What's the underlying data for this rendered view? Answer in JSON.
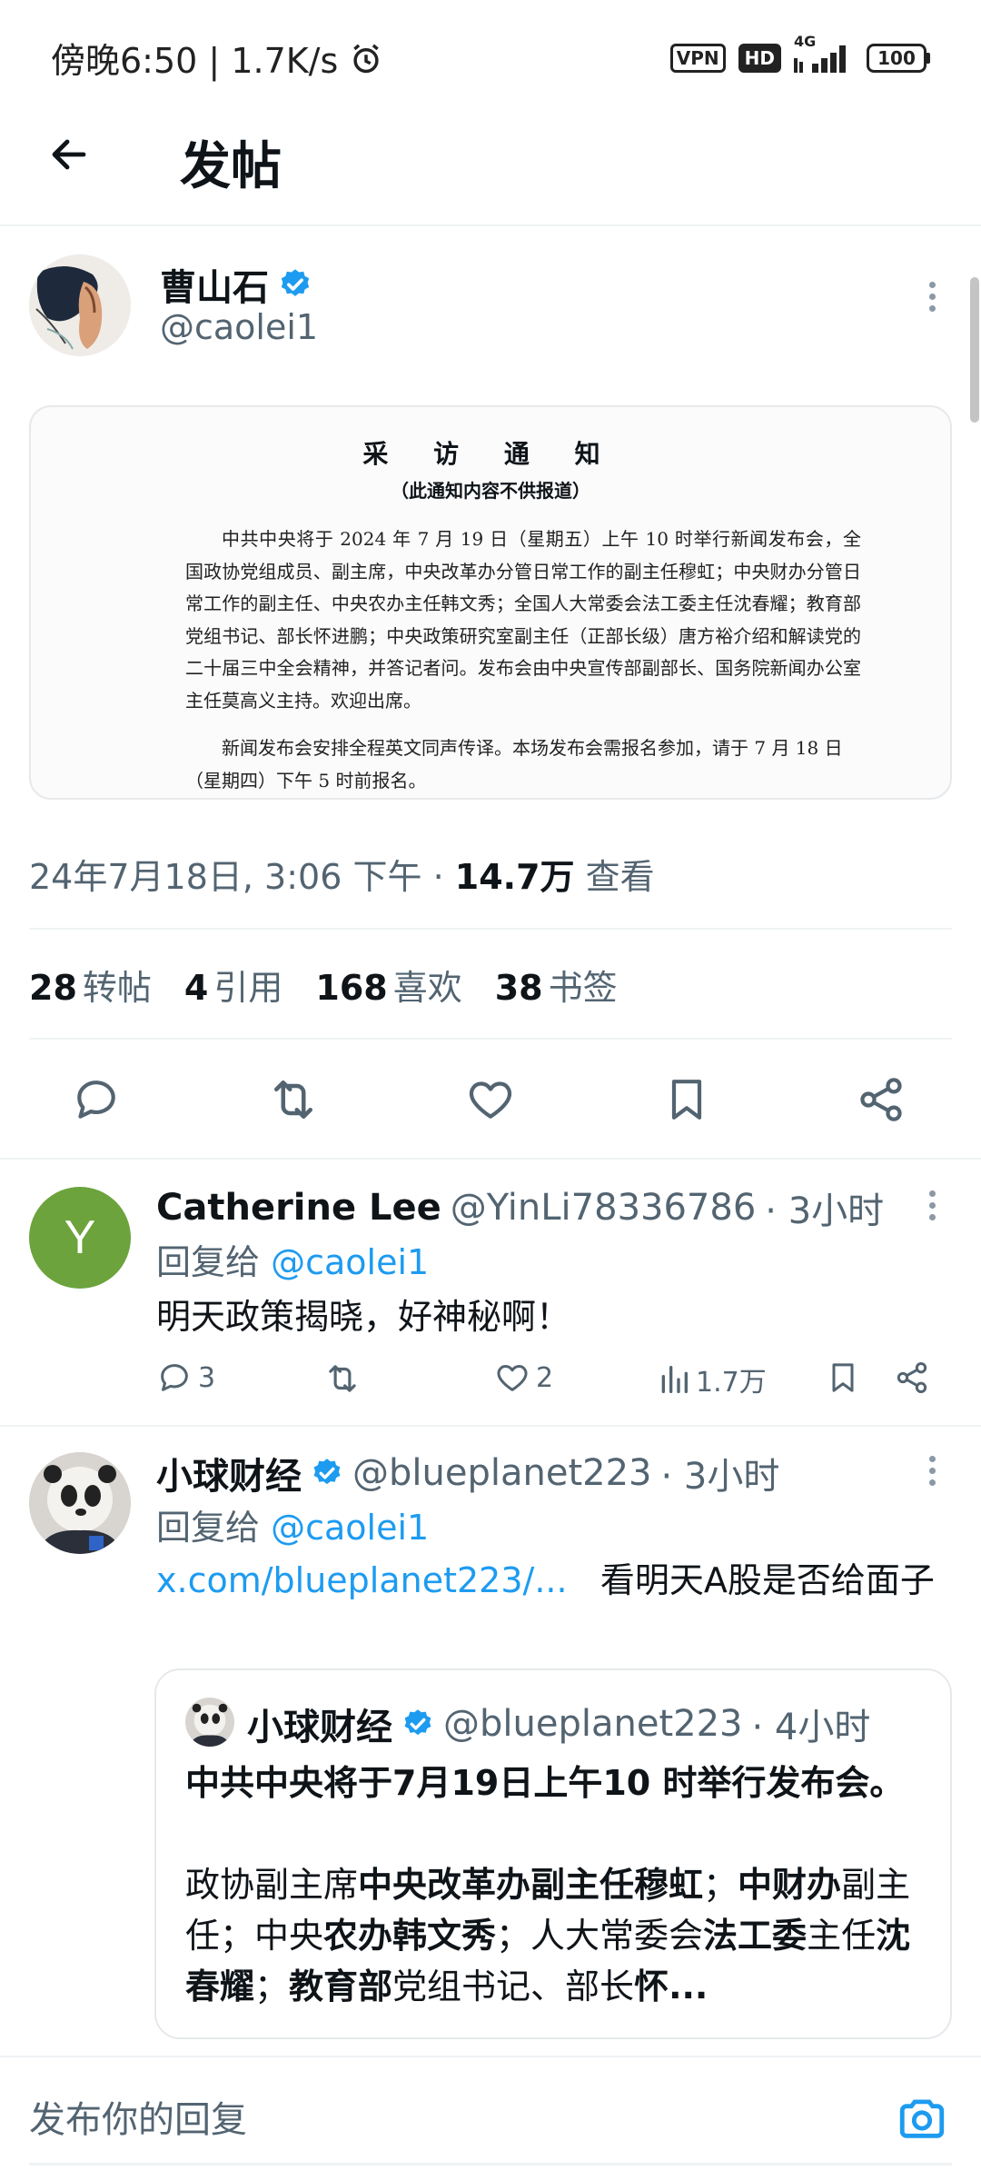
{
  "status_bar": {
    "time": "傍晚6:50",
    "speed": "1.7K/s",
    "vpn": "VPN",
    "hd": "HD",
    "network": "4G",
    "battery": "100"
  },
  "header": {
    "title": "发帖"
  },
  "post": {
    "author_name": "曹山石",
    "author_handle": "@caolei1",
    "image": {
      "title": "采 访 通 知",
      "subtitle": "（此通知内容不供报道）",
      "body": "中共中央将于 2024 年 7 月 19 日（星期五）上午 10 时举行新闻发布会，全国政协党组成员、副主席，中央改革办分管日常工作的副主任穆虹；中央财办分管日常工作的副主任、中央农办主任韩文秀；全国人大常委会法工委主任沈春耀；教育部党组书记、部长怀进鹏；中央政策研究室副主任（正部长级）唐方裕介绍和解读党的二十届三中全会精神，并答记者问。发布会由中央宣传部副部长、国务院新闻办公室主任莫高义主持。欢迎出席。",
      "body2": "新闻发布会安排全程英文同声传译。本场发布会需报名参加，请于 7 月 18 日（星期四）下午 5 时前报名。"
    },
    "timestamp": "24年7月18日, 3:06 下午",
    "separator": "·",
    "views_count": "14.7万",
    "views_label": "查看",
    "stats": {
      "reposts_count": "28",
      "reposts_label": "转帖",
      "quotes_count": "4",
      "quotes_label": "引用",
      "likes_count": "168",
      "likes_label": "喜欢",
      "bookmarks_count": "38",
      "bookmarks_label": "书签"
    }
  },
  "replies": [
    {
      "avatar_letter": "Y",
      "avatar_color": "#6ca33d",
      "name": "Catherine Lee",
      "handle": "@YinLi78336786",
      "time": "· 3小时",
      "reply_to_label": "回复给",
      "reply_to_handle": "@caolei1",
      "text": "明天政策揭晓，好神秘啊！",
      "reply_count": "3",
      "like_count": "2",
      "view_count": "1.7万"
    },
    {
      "name": "小球财经",
      "handle": "@blueplanet223",
      "time": "· 3小时",
      "reply_to_label": "回复给",
      "reply_to_handle": "@caolei1",
      "link": "x.com/blueplanet223/...",
      "text_after_link": "看明天A股是否给面子",
      "quote": {
        "name": "小球财经",
        "handle": "@blueplanet223",
        "time": "· 4小时",
        "headline": "中共中央将于7月19日上午10 时举行发布会。",
        "p1": "政协副主席",
        "b1": "中央改革办副主任穆虹",
        "p2": "；",
        "b2": "中财办",
        "p3": "副主任；中央",
        "b3": "农办韩文秀",
        "p4": "；人大常委会",
        "b4": "法工委",
        "p5": "主任",
        "b5": "沈春耀",
        "p6": "；",
        "b6": "教育部",
        "p7": "党组书记、部长",
        "b7": "怀..."
      }
    }
  ],
  "compose": {
    "placeholder": "发布你的回复"
  },
  "colors": {
    "accent": "#1d9bf0",
    "text": "#0f1419",
    "muted": "#536471"
  }
}
